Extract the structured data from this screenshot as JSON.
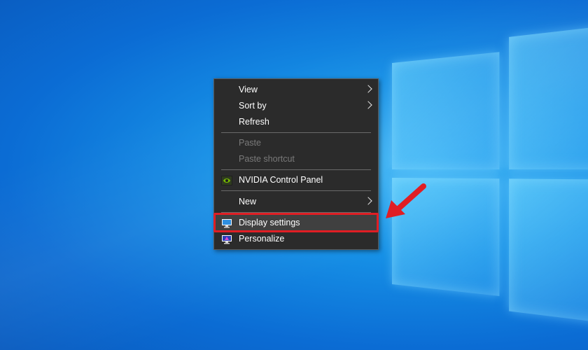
{
  "desktop": {
    "background": "windows-10-blue-wallpaper"
  },
  "context_menu": {
    "items": [
      {
        "label": "View",
        "submenu": true,
        "disabled": false
      },
      {
        "label": "Sort by",
        "submenu": true,
        "disabled": false
      },
      {
        "label": "Refresh",
        "submenu": false,
        "disabled": false
      },
      {
        "label": "Paste",
        "submenu": false,
        "disabled": true
      },
      {
        "label": "Paste shortcut",
        "submenu": false,
        "disabled": true
      },
      {
        "label": "NVIDIA Control Panel",
        "submenu": false,
        "disabled": false,
        "icon": "nvidia-icon"
      },
      {
        "label": "New",
        "submenu": true,
        "disabled": false
      },
      {
        "label": "Display settings",
        "submenu": false,
        "disabled": false,
        "icon": "display-icon",
        "highlighted": true
      },
      {
        "label": "Personalize",
        "submenu": false,
        "disabled": false,
        "icon": "personalize-icon"
      }
    ]
  },
  "annotation": {
    "highlight_color": "#e01e24",
    "arrow_icon": "red-arrow-icon"
  }
}
